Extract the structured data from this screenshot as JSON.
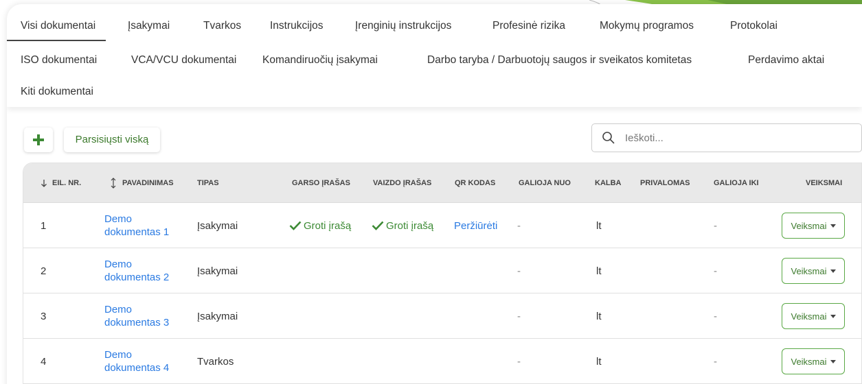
{
  "colors": {
    "accent_green": "#3c8a34",
    "link_blue": "#2a7ae2",
    "corner_green": "#7cb342"
  },
  "tabs": {
    "row1": [
      "Visi dokumentai",
      "Įsakymai",
      "Tvarkos",
      "Instrukcijos",
      "Įrenginių instrukcijos",
      "Profesinė rizika",
      "Mokymų programos",
      "Protokolai"
    ],
    "row2": [
      "ISO dokumentai",
      "VCA/VCU dokumentai",
      "Komandiruočių įsakymai",
      "Darbo taryba / Darbuotojų saugos ir sveikatos komitetas",
      "Perdavimo aktai"
    ],
    "row3": [
      "Kiti dokumentai"
    ],
    "active": "Visi dokumentai"
  },
  "toolbar": {
    "add_icon": "plus-icon",
    "download_all_label": "Parsisiųsti viską",
    "search_placeholder": "Ieškoti...",
    "search_icon": "search-icon"
  },
  "table": {
    "headers": {
      "no": "EIL. NR.",
      "name": "PAVADINIMAS",
      "type": "TIPAS",
      "audio": "GARSO ĮRAŠAS",
      "video": "VAIZDO ĮRAŠAS",
      "qr": "QR KODAS",
      "valid_from": "GALIOJA NUO",
      "lang": "KALBA",
      "mandatory": "PRIVALOMAS",
      "valid_to": "GALIOJA IKI",
      "actions": "VEIKSMAI"
    },
    "rows": [
      {
        "no": "1",
        "name": "Demo dokumentas 1",
        "type": "Įsakymai",
        "audio": "Groti įrašą",
        "video": "Groti įrašą",
        "qr": "Peržiūrėti",
        "valid_from": "-",
        "lang": "lt",
        "mandatory": "",
        "valid_to": "-",
        "action": "Veiksmai"
      },
      {
        "no": "2",
        "name": "Demo dokumentas 2",
        "type": "Įsakymai",
        "audio": "",
        "video": "",
        "qr": "",
        "valid_from": "-",
        "lang": "lt",
        "mandatory": "",
        "valid_to": "-",
        "action": "Veiksmai"
      },
      {
        "no": "3",
        "name": "Demo dokumentas 3",
        "type": "Įsakymai",
        "audio": "",
        "video": "",
        "qr": "",
        "valid_from": "-",
        "lang": "lt",
        "mandatory": "",
        "valid_to": "-",
        "action": "Veiksmai"
      },
      {
        "no": "4",
        "name": "Demo dokumentas 4",
        "type": "Tvarkos",
        "audio": "",
        "video": "",
        "qr": "",
        "valid_from": "-",
        "lang": "lt",
        "mandatory": "",
        "valid_to": "-",
        "action": "Veiksmai"
      }
    ]
  }
}
